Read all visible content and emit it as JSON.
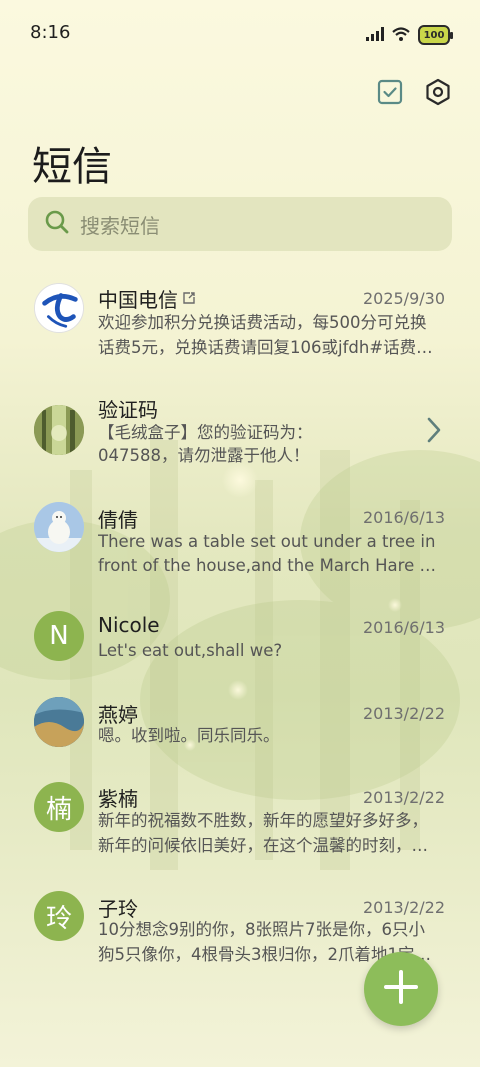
{
  "status_bar": {
    "time": "8:16",
    "battery_level": "100",
    "icons": [
      "signal-icon",
      "wifi-icon",
      "battery-icon"
    ]
  },
  "top_actions": {
    "icons": [
      "select-checkbox-icon",
      "settings-hexagon-icon"
    ]
  },
  "title": "短信",
  "search": {
    "placeholder": "搜索短信"
  },
  "conversations": [
    {
      "name": "中国电信",
      "date": "2025/9/30",
      "line1": "欢迎参加积分兑换话费活动，每500分可兑换",
      "line2": "话费5元，兑换话费请回复106或jfdh#话费…",
      "avatar": "china-telecom-logo"
    },
    {
      "name": "验证码",
      "date": "",
      "line1": "【毛绒盒子】您的验证码为：",
      "line2": "047588，请勿泄露于他人！",
      "avatar": "forest-photo"
    },
    {
      "name": "倩倩",
      "date": "2016/6/13",
      "line1": "There was a table set out under a tree in",
      "line2": "front of the house,and the March Hare an…",
      "avatar": "polar-bear-photo"
    },
    {
      "name": "Nicole",
      "date": "2016/6/13",
      "line1": "Let's eat out,shall we?",
      "line2": "",
      "avatar_letter": "N"
    },
    {
      "name": "燕婷",
      "date": "2013/2/22",
      "line1": "嗯。收到啦。同乐同乐。",
      "line2": "",
      "avatar": "sea-photo"
    },
    {
      "name": "紫楠",
      "date": "2013/2/22",
      "line1": "新年的祝福数不胜数，新年的愿望好多好多，",
      "line2": "新年的问候依旧美好，在这个温馨的时刻，…",
      "avatar_letter": "楠"
    },
    {
      "name": "子玲",
      "date": "2013/2/22",
      "line1": "10分想念9别的你，8张照片7张是你，6只小",
      "line2": "狗5只像你，4根骨头3根归你，2爪着地1宝…",
      "avatar_letter": "玲"
    }
  ],
  "fab": {
    "icon": "plus-icon"
  },
  "colors": {
    "accent": "#8db44f",
    "fab": "#8dbd5a",
    "search_bg": "#e3e5bf",
    "background": "#f8f7d9"
  }
}
